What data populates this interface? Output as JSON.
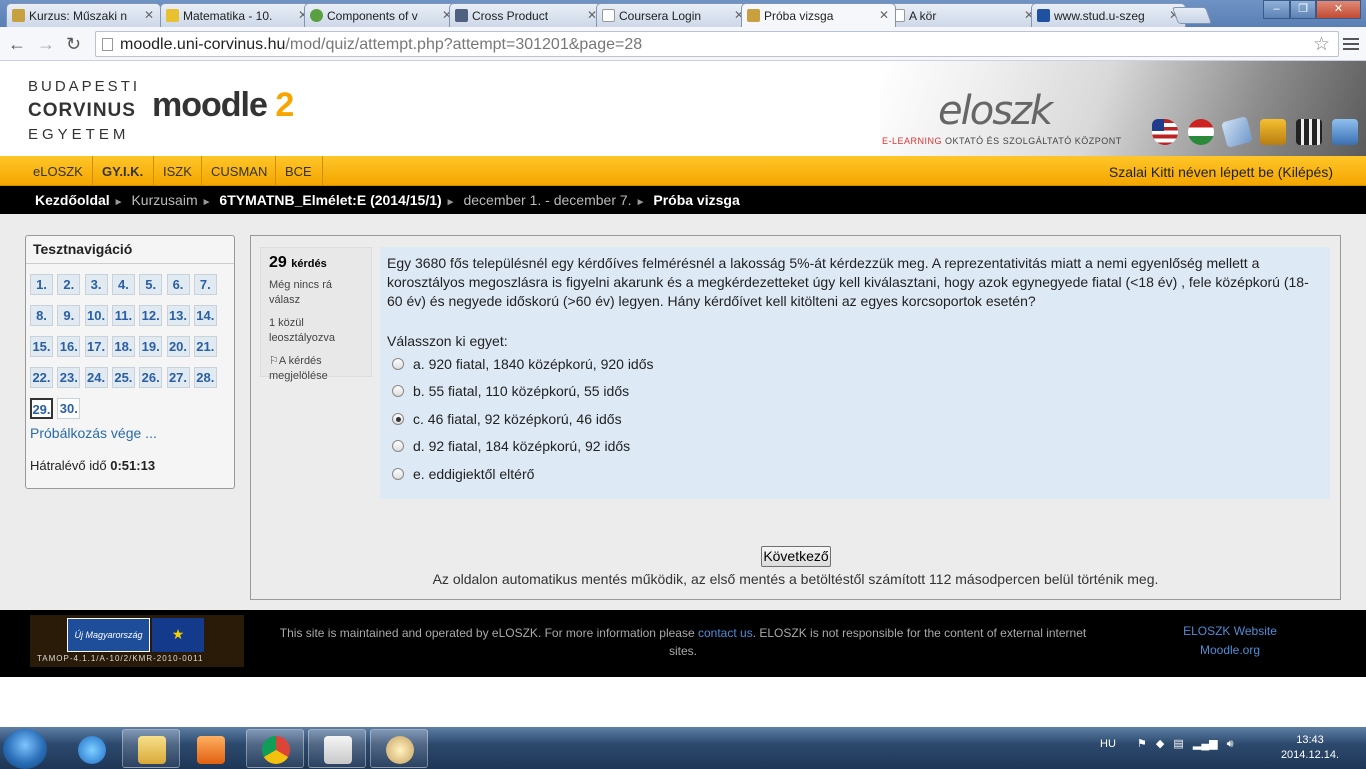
{
  "browser": {
    "tabs": [
      {
        "title": "Kurzus: Műszaki n",
        "fav": "#c8a040"
      },
      {
        "title": "Matematika - 10.",
        "fav": "#e8c030"
      },
      {
        "title": "Components of v",
        "fav": "#5aa040"
      },
      {
        "title": "Cross Product",
        "fav": "#506080"
      },
      {
        "title": "Coursera Login",
        "fav": "#ffffff"
      },
      {
        "title": "Próba vizsga",
        "fav": "#c8a040"
      },
      {
        "title": "A kör",
        "fav": "#ffffff"
      },
      {
        "title": "www.stud.u-szeg",
        "fav": "#2050a0"
      }
    ],
    "url_host": "moodle.uni-corvinus.hu",
    "url_path": "/mod/quiz/attempt.php?attempt=301201&page=28"
  },
  "header": {
    "uni_line1": "BUDAPESTI",
    "uni_line2": "CORVINUS",
    "uni_line3": "EGYETEM",
    "moodle": "moodle",
    "moodle_version": "2",
    "eloszk": "eloszk",
    "eloszk_sub_red": "E-LEARNING",
    "eloszk_sub_rest": " OKTATÓ ÉS SZOLGÁLTATÓ KÖZPONT"
  },
  "topnav": {
    "items": [
      "eLOSZK",
      "GY.I.K.",
      "ISZK",
      "CUSMAN",
      "BCE"
    ],
    "login": "Szalai Kitti néven lépett be (Kilépés)"
  },
  "breadcrumb": {
    "home": "Kezdőoldal",
    "courses": "Kurzusaim",
    "course": "6TYMATNB_Elmélet:E (2014/15/1)",
    "week": "december 1. - december 7.",
    "current": "Próba vizsga"
  },
  "quiznav": {
    "title": "Tesztnavigáció",
    "buttons": [
      "1.",
      "2.",
      "3.",
      "4.",
      "5.",
      "6.",
      "7.",
      "8.",
      "9.",
      "10.",
      "11.",
      "12.",
      "13.",
      "14.",
      "15.",
      "16.",
      "17.",
      "18.",
      "19.",
      "20.",
      "21.",
      "22.",
      "23.",
      "24.",
      "25.",
      "26.",
      "27.",
      "28.",
      "29.",
      "30."
    ],
    "finish": "Próbálkozás vége ...",
    "time_label": "Hátralévő idő",
    "time_value": "0:51:13"
  },
  "question": {
    "number": "29",
    "number_label": "kérdés",
    "state": "Még nincs rá válasz",
    "grade": "1 közül leosztályozva",
    "flag": "A kérdés megjelölése",
    "text": "Egy 3680 fős településnél egy kérdőíves felmérésnél a lakosság 5%-át kérdezzük meg. A reprezentativitás miatt a nemi egyenlőség mellett a korosztályos megoszlásra is figyelni akarunk és a megkérdezetteket úgy kell kiválasztani, hogy  azok egynegyede fiatal (<18 év) , fele középkorú (18- 60 év) és negyede időskorú (>60 év) legyen. Hány kérdőívet kell kitölteni az egyes korcsoportok esetén?",
    "prompt": "Válasszon ki egyet:",
    "options": [
      "a. 920 fiatal, 1840 középkorú, 920 idős",
      "b. 55 fiatal, 110 középkorú, 55 idős",
      "c. 46 fiatal, 92 középkorú, 46  idős",
      "d. 92 fiatal, 184 középkorú, 92 idős",
      "e. eddigiektől eltérő"
    ],
    "selected_option": "c. 46 fiatal, 92 középkorú, 46  idős"
  },
  "next_button": "Következő",
  "autosave": "Az oldalon automatikus mentés működik, az első mentés a betöltéstől számított 112 másodpercen belül történik meg.",
  "footer": {
    "eu_flag_text": "Új Magyarország",
    "eu_code": "TAMOP-4.1.1/A-10/2/KMR-2010-0011",
    "text_before": "This site is maintained and operated by eLOSZK. For more information please ",
    "contact": "contact us",
    "text_after": ". ELOSZK is not responsible for the content of external internet sites.",
    "link1": "ELOSZK Website",
    "link2": "Moodle.org"
  },
  "taskbar": {
    "lang": "HU",
    "time": "13:43",
    "date": "2014.12.14."
  }
}
